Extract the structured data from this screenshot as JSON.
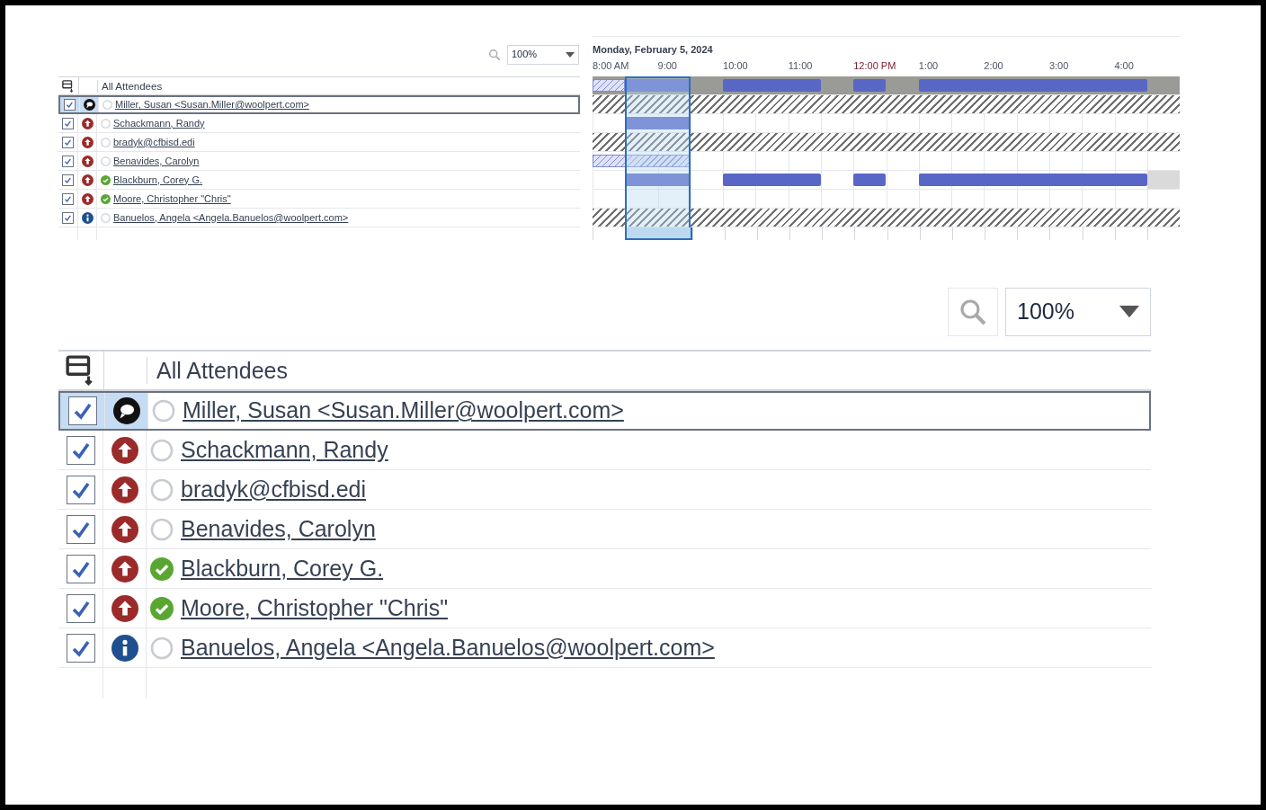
{
  "top": {
    "zoom": {
      "value": "100%"
    },
    "header": {
      "label": "All Attendees"
    },
    "attendees": [
      {
        "name": "Miller, Susan <Susan.Miller@woolpert.com>",
        "checked": true,
        "kind": "organizer",
        "accepted": false,
        "selected": true
      },
      {
        "name": "Schackmann, Randy",
        "checked": true,
        "kind": "required",
        "accepted": false,
        "selected": false
      },
      {
        "name": "bradyk@cfbisd.edi",
        "checked": true,
        "kind": "required",
        "accepted": false,
        "selected": false
      },
      {
        "name": "Benavides, Carolyn",
        "checked": true,
        "kind": "required",
        "accepted": false,
        "selected": false
      },
      {
        "name": "Blackburn, Corey G.",
        "checked": true,
        "kind": "required",
        "accepted": true,
        "selected": false
      },
      {
        "name": "Moore, Christopher \"Chris\"",
        "checked": true,
        "kind": "required",
        "accepted": true,
        "selected": false
      },
      {
        "name": "Banuelos, Angela <Angela.Banuelos@woolpert.com>",
        "checked": true,
        "kind": "optional",
        "accepted": false,
        "selected": false
      }
    ],
    "schedule": {
      "date": "Monday, February 5, 2024",
      "times": [
        {
          "label": "8:00 AM",
          "kind": "plain"
        },
        {
          "label": "9:00",
          "kind": "plain"
        },
        {
          "label": "10:00",
          "kind": "plain"
        },
        {
          "label": "11:00",
          "kind": "plain"
        },
        {
          "label": "12:00 PM",
          "kind": "noon"
        },
        {
          "label": "1:00",
          "kind": "plain"
        },
        {
          "label": "2:00",
          "kind": "plain"
        },
        {
          "label": "3:00",
          "kind": "plain"
        },
        {
          "label": "4:00",
          "kind": "plain"
        }
      ],
      "slots": [
        {
          "selected": false
        },
        {
          "selected": true
        },
        {
          "selected": true
        },
        {
          "selected": false
        },
        {
          "selected": false
        },
        {
          "selected": false
        },
        {
          "selected": false
        },
        {
          "selected": false
        },
        {
          "selected": false
        },
        {
          "selected": false
        },
        {
          "selected": false
        },
        {
          "selected": false
        },
        {
          "selected": false
        },
        {
          "selected": false
        },
        {
          "selected": false
        },
        {
          "selected": false
        },
        {
          "selected": false
        },
        {
          "selected": false
        }
      ],
      "rows": [
        {
          "kind": "summary",
          "slots": [
            {
              "kind": "tentative"
            },
            {
              "kind": "busy"
            },
            {
              "kind": "busy"
            },
            {
              "kind": "free"
            },
            {
              "kind": "busy"
            },
            {
              "kind": "busy"
            },
            {
              "kind": "busy"
            },
            {
              "kind": "free"
            },
            {
              "kind": "busy"
            },
            {
              "kind": "free"
            },
            {
              "kind": "busy"
            },
            {
              "kind": "busy"
            },
            {
              "kind": "busy"
            },
            {
              "kind": "busy"
            },
            {
              "kind": "busy"
            },
            {
              "kind": "busy"
            },
            {
              "kind": "busy"
            },
            {
              "kind": "free"
            }
          ]
        },
        {
          "kind": "no_info",
          "slots": []
        },
        {
          "kind": "free",
          "slots": [
            {
              "kind": "free"
            },
            {
              "kind": "busy"
            },
            {
              "kind": "busy"
            }
          ]
        },
        {
          "kind": "no_info",
          "slots": []
        },
        {
          "kind": "free",
          "slots": [
            {
              "kind": "tentative"
            },
            {
              "kind": "tentative"
            },
            {
              "kind": "tentative"
            }
          ]
        },
        {
          "kind": "free",
          "slots": [
            {
              "kind": "free"
            },
            {
              "kind": "busy"
            },
            {
              "kind": "busy"
            },
            {
              "kind": "free"
            },
            {
              "kind": "busy"
            },
            {
              "kind": "busy"
            },
            {
              "kind": "busy"
            },
            {
              "kind": "free"
            },
            {
              "kind": "busy"
            },
            {
              "kind": "free"
            },
            {
              "kind": "busy"
            },
            {
              "kind": "busy"
            },
            {
              "kind": "busy"
            },
            {
              "kind": "busy"
            },
            {
              "kind": "busy"
            },
            {
              "kind": "busy"
            },
            {
              "kind": "busy"
            },
            {
              "kind": "away"
            }
          ]
        },
        {
          "kind": "free",
          "slots": []
        },
        {
          "kind": "no_info",
          "slots": []
        }
      ]
    }
  },
  "bottom": {
    "zoom": {
      "value": "100%"
    },
    "header": {
      "label": "All Attendees"
    },
    "attendees": [
      {
        "name": "Miller, Susan <Susan.Miller@woolpert.com>",
        "checked": true,
        "kind": "organizer",
        "accepted": false,
        "selected": true
      },
      {
        "name": "Schackmann, Randy",
        "checked": true,
        "kind": "required",
        "accepted": false,
        "selected": false
      },
      {
        "name": "bradyk@cfbisd.edi",
        "checked": true,
        "kind": "required",
        "accepted": false,
        "selected": false
      },
      {
        "name": "Benavides, Carolyn",
        "checked": true,
        "kind": "required",
        "accepted": false,
        "selected": false
      },
      {
        "name": "Blackburn, Corey G.",
        "checked": true,
        "kind": "required",
        "accepted": true,
        "selected": false
      },
      {
        "name": "Moore, Christopher \"Chris\"",
        "checked": true,
        "kind": "required",
        "accepted": true,
        "selected": false
      },
      {
        "name": "Banuelos, Angela <Angela.Banuelos@woolpert.com>",
        "checked": true,
        "kind": "optional",
        "accepted": false,
        "selected": false
      }
    ]
  }
}
